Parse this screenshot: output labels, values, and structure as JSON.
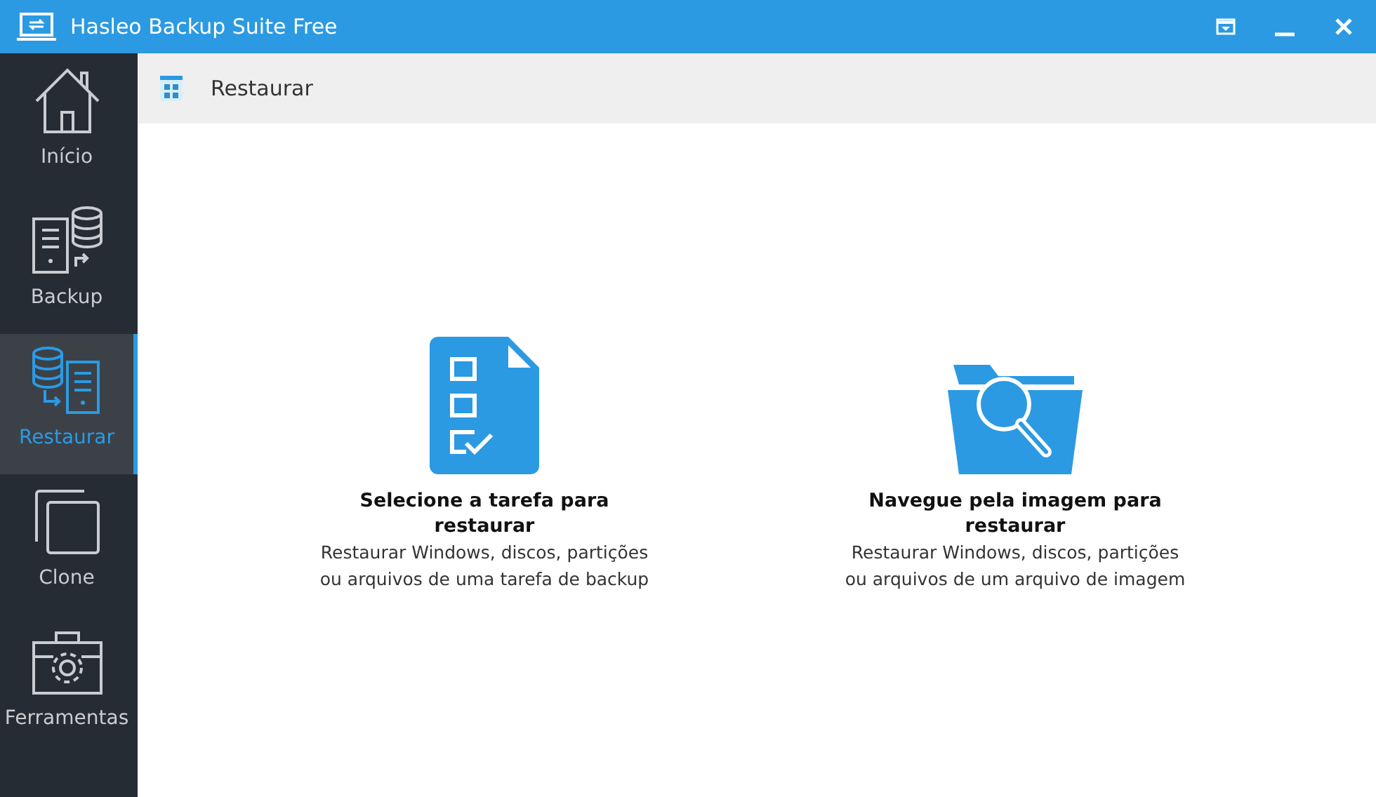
{
  "window": {
    "title": "Hasleo Backup Suite Free"
  },
  "sidebar": {
    "items": [
      {
        "kind": "home",
        "label": "Início",
        "selected": false
      },
      {
        "kind": "backup",
        "label": "Backup",
        "selected": false
      },
      {
        "kind": "restore",
        "label": "Restaurar",
        "selected": true
      },
      {
        "kind": "clone",
        "label": "Clone",
        "selected": false
      },
      {
        "kind": "tools",
        "label": "Ferramentas",
        "selected": false
      }
    ]
  },
  "header": {
    "title": "Restaurar"
  },
  "options": [
    {
      "kind": "task",
      "title": "Selecione a tarefa para restaurar",
      "description": "Restaurar Windows, discos, partições ou arquivos de uma tarefa de backup"
    },
    {
      "kind": "image",
      "title": "Navegue pela imagem para restaurar",
      "description": "Restaurar Windows, discos, partições ou arquivos de um arquivo de imagem"
    }
  ]
}
